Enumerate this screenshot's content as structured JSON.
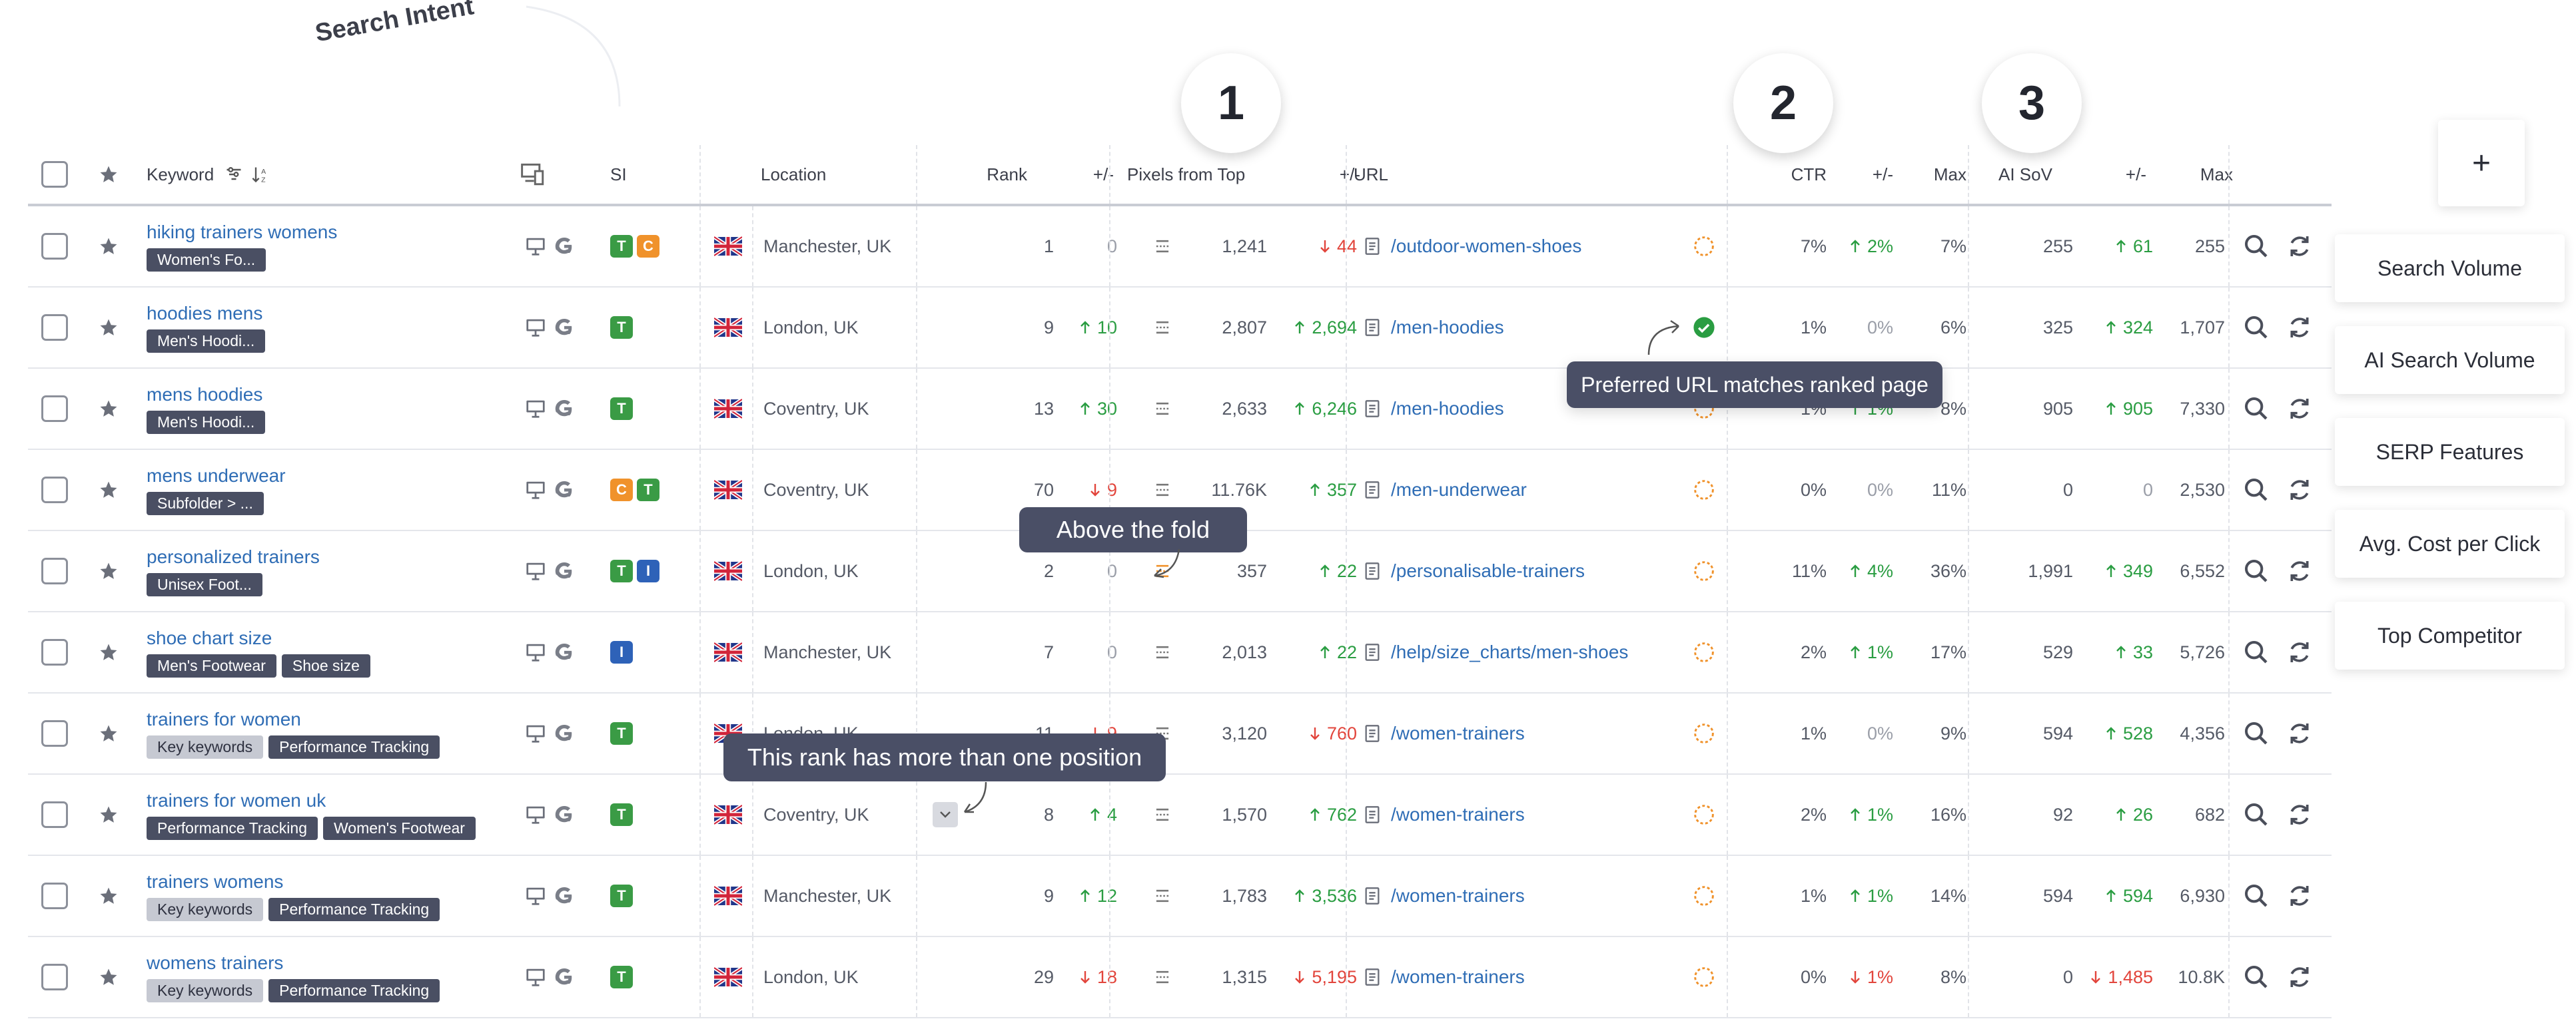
{
  "annotations": {
    "search_intent_label": "Search Intent",
    "num1": "1",
    "num2": "2",
    "num3": "3",
    "tooltip_fold": "Above the fold",
    "tooltip_rank": "This rank has more than one position",
    "tooltip_url": "Preferred URL matches ranked page"
  },
  "header": {
    "keyword": "Keyword",
    "si": "SI",
    "location": "Location",
    "rank": "Rank",
    "rank_change": "+/-",
    "pixels": "Pixels from Top",
    "pixels_change": "+/-",
    "url": "URL",
    "ctr": "CTR",
    "ctr_change": "+/-",
    "ctr_max": "Max",
    "aisov": "AI SoV",
    "aisov_change": "+/-",
    "aisov_max": "Max"
  },
  "side_panel": {
    "add_label": "+",
    "items": [
      "Search Volume",
      "AI Search Volume",
      "SERP Features",
      "Avg. Cost per Click",
      "Top Competitor"
    ]
  },
  "rows": [
    {
      "keyword": "hiking trainers womens",
      "tags": [
        {
          "t": "Women's Fo...",
          "light": false
        }
      ],
      "si": [
        "T",
        "C"
      ],
      "location": "Manchester, UK",
      "rank": "1",
      "rank_change": "0",
      "rank_dir": "neutral",
      "pixels": "1,241",
      "pixels_change": "44",
      "pixels_dir": "down",
      "url": "/outdoor-women-shoes",
      "url_status": "pending",
      "ctr": "7%",
      "ctr_change": "2%",
      "ctr_dir": "up",
      "ctr_max": "7%",
      "aisov": "255",
      "aisov_change": "61",
      "aisov_dir": "up",
      "aisov_max": "255"
    },
    {
      "keyword": "hoodies mens",
      "tags": [
        {
          "t": "Men's Hoodi...",
          "light": false
        }
      ],
      "si": [
        "T"
      ],
      "location": "London, UK",
      "rank": "9",
      "rank_change": "10",
      "rank_dir": "up",
      "pixels": "2,807",
      "pixels_change": "2,694",
      "pixels_dir": "up",
      "url": "/men-hoodies",
      "url_status": "match",
      "ctr": "1%",
      "ctr_change": "0%",
      "ctr_dir": "neutral",
      "ctr_max": "6%",
      "aisov": "325",
      "aisov_change": "324",
      "aisov_dir": "up",
      "aisov_max": "1,707"
    },
    {
      "keyword": "mens hoodies",
      "tags": [
        {
          "t": "Men's Hoodi...",
          "light": false
        }
      ],
      "si": [
        "T"
      ],
      "location": "Coventry, UK",
      "rank": "13",
      "rank_change": "30",
      "rank_dir": "up",
      "pixels": "2,633",
      "pixels_change": "6,246",
      "pixels_dir": "up",
      "url": "/men-hoodies",
      "url_status": "pending",
      "ctr": "1%",
      "ctr_change": "1%",
      "ctr_dir": "up",
      "ctr_max": "8%",
      "aisov": "905",
      "aisov_change": "905",
      "aisov_dir": "up",
      "aisov_max": "7,330"
    },
    {
      "keyword": "mens underwear",
      "tags": [
        {
          "t": "Subfolder > ...",
          "light": false
        }
      ],
      "si": [
        "C",
        "T"
      ],
      "location": "Coventry, UK",
      "rank": "70",
      "rank_change": "9",
      "rank_dir": "down",
      "pixels": "11.76K",
      "pixels_change": "357",
      "pixels_dir": "up",
      "url": "/men-underwear",
      "url_status": "pending",
      "ctr": "0%",
      "ctr_change": "0%",
      "ctr_dir": "neutral",
      "ctr_max": "11%",
      "aisov": "0",
      "aisov_change": "0",
      "aisov_dir": "neutral",
      "aisov_max": "2,530"
    },
    {
      "keyword": "personalized trainers",
      "tags": [
        {
          "t": "Unisex Foot...",
          "light": false
        }
      ],
      "si": [
        "T",
        "I"
      ],
      "location": "London, UK",
      "rank": "2",
      "rank_change": "0",
      "rank_dir": "neutral",
      "pixels": "357",
      "pixels_change": "22",
      "pixels_dir": "up",
      "url": "/personalisable-trainers",
      "url_status": "pending",
      "ctr": "11%",
      "ctr_change": "4%",
      "ctr_dir": "up",
      "ctr_max": "36%",
      "aisov": "1,991",
      "aisov_change": "349",
      "aisov_dir": "up",
      "aisov_max": "6,552"
    },
    {
      "keyword": "shoe chart size",
      "tags": [
        {
          "t": "Men's Footwear",
          "light": false
        },
        {
          "t": "Shoe size",
          "light": false
        }
      ],
      "si": [
        "I"
      ],
      "location": "Manchester, UK",
      "rank": "7",
      "rank_change": "0",
      "rank_dir": "neutral",
      "pixels": "2,013",
      "pixels_change": "22",
      "pixels_dir": "up",
      "url": "/help/size_charts/men-shoes",
      "url_status": "pending",
      "ctr": "2%",
      "ctr_change": "1%",
      "ctr_dir": "up",
      "ctr_max": "17%",
      "aisov": "529",
      "aisov_change": "33",
      "aisov_dir": "up",
      "aisov_max": "5,726"
    },
    {
      "keyword": "trainers for women",
      "tags": [
        {
          "t": "Key keywords",
          "light": true
        },
        {
          "t": "Performance Tracking",
          "light": false
        }
      ],
      "si": [
        "T"
      ],
      "location": "London, UK",
      "rank": "11",
      "rank_change": "9",
      "rank_dir": "down",
      "pixels": "3,120",
      "pixels_change": "760",
      "pixels_dir": "down",
      "url": "/women-trainers",
      "url_status": "pending",
      "ctr": "1%",
      "ctr_change": "0%",
      "ctr_dir": "neutral",
      "ctr_max": "9%",
      "aisov": "594",
      "aisov_change": "528",
      "aisov_dir": "up",
      "aisov_max": "4,356"
    },
    {
      "keyword": "trainers for women uk",
      "tags": [
        {
          "t": "Performance Tracking",
          "light": false
        },
        {
          "t": "Women's Footwear",
          "light": false
        }
      ],
      "si": [
        "T"
      ],
      "location": "Coventry, UK",
      "rank": "8",
      "rank_change": "4",
      "rank_dir": "up",
      "pixels": "1,570",
      "pixels_change": "762",
      "pixels_dir": "up",
      "url": "/women-trainers",
      "url_status": "pending",
      "ctr": "2%",
      "ctr_change": "1%",
      "ctr_dir": "up",
      "ctr_max": "16%",
      "aisov": "92",
      "aisov_change": "26",
      "aisov_dir": "up",
      "aisov_max": "682"
    },
    {
      "keyword": "trainers womens",
      "tags": [
        {
          "t": "Key keywords",
          "light": true
        },
        {
          "t": "Performance Tracking",
          "light": false
        }
      ],
      "si": [
        "T"
      ],
      "location": "Manchester, UK",
      "rank": "9",
      "rank_change": "12",
      "rank_dir": "up",
      "pixels": "1,783",
      "pixels_change": "3,536",
      "pixels_dir": "up",
      "url": "/women-trainers",
      "url_status": "pending",
      "ctr": "1%",
      "ctr_change": "1%",
      "ctr_dir": "up",
      "ctr_max": "14%",
      "aisov": "594",
      "aisov_change": "594",
      "aisov_dir": "up",
      "aisov_max": "6,930"
    },
    {
      "keyword": "womens trainers",
      "tags": [
        {
          "t": "Key keywords",
          "light": true
        },
        {
          "t": "Performance Tracking",
          "light": false
        }
      ],
      "si": [
        "T"
      ],
      "location": "London, UK",
      "rank": "29",
      "rank_change": "18",
      "rank_dir": "down",
      "pixels": "1,315",
      "pixels_change": "5,195",
      "pixels_dir": "down",
      "url": "/women-trainers",
      "url_status": "pending",
      "ctr": "0%",
      "ctr_change": "1%",
      "ctr_dir": "down",
      "ctr_max": "8%",
      "aisov": "0",
      "aisov_change": "1,485",
      "aisov_dir": "down",
      "aisov_max": "10.8K"
    }
  ]
}
